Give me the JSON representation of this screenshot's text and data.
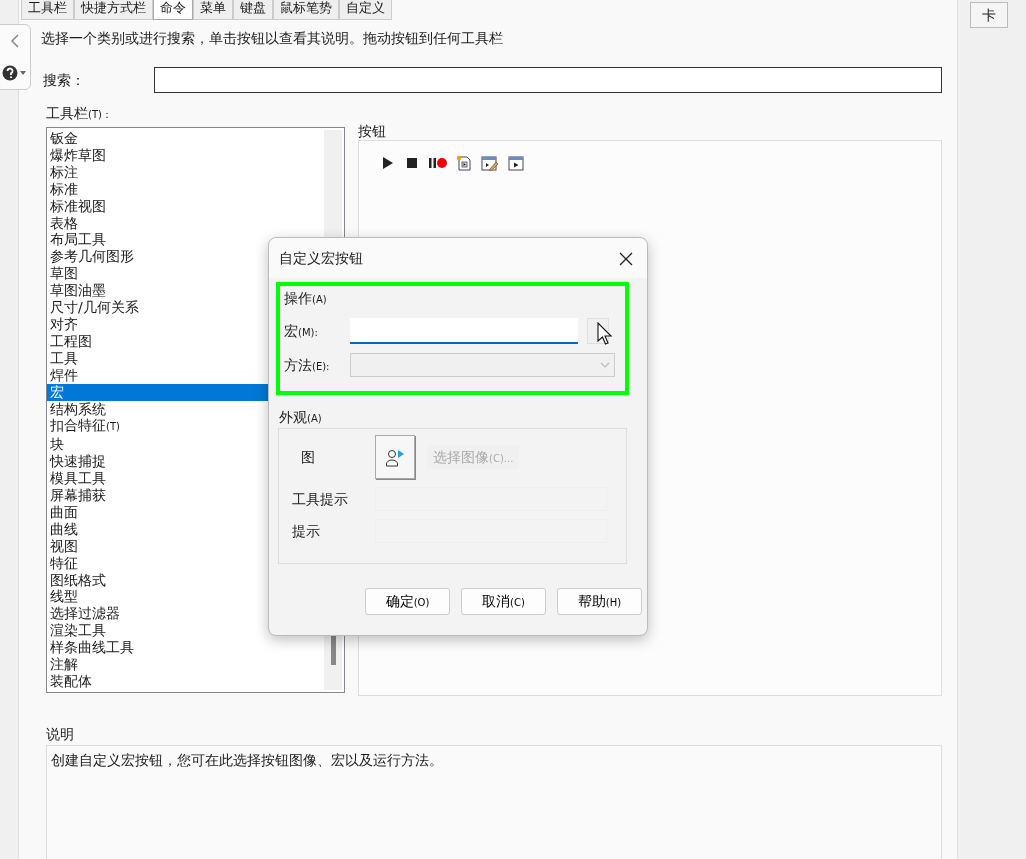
{
  "tabs": [
    {
      "label": "工具栏",
      "selected": false
    },
    {
      "label": "快捷方式栏",
      "selected": false
    },
    {
      "label": "命令",
      "selected": true
    },
    {
      "label": "菜单",
      "selected": false
    },
    {
      "label": "键盘",
      "selected": false
    },
    {
      "label": "鼠标笔势",
      "selected": false
    },
    {
      "label": "自定义",
      "selected": false
    }
  ],
  "right_strip": {
    "label": "卡"
  },
  "instruction": "选择一个类别或进行搜索，单击按钮以查看其说明。拖动按钮到任何工具栏",
  "search": {
    "label": "搜索："
  },
  "toolbars": {
    "label": "工具栏",
    "hotkey": "(T)：",
    "items": [
      {
        "label": "钣金",
        "selected": false
      },
      {
        "label": "爆炸草图",
        "selected": false
      },
      {
        "label": "标注",
        "selected": false
      },
      {
        "label": "标准",
        "selected": false
      },
      {
        "label": "标准视图",
        "selected": false
      },
      {
        "label": "表格",
        "selected": false
      },
      {
        "label": "布局工具",
        "selected": false
      },
      {
        "label": "参考几何图形",
        "selected": false
      },
      {
        "label": "草图",
        "selected": false
      },
      {
        "label": "草图油墨",
        "selected": false
      },
      {
        "label": "尺寸/几何关系",
        "selected": false
      },
      {
        "label": "对齐",
        "selected": false
      },
      {
        "label": "工程图",
        "selected": false
      },
      {
        "label": "工具",
        "selected": false
      },
      {
        "label": "焊件",
        "selected": false
      },
      {
        "label": "宏",
        "selected": true
      },
      {
        "label": "结构系统",
        "selected": false
      },
      {
        "label": "扣合特征",
        "hotkey": "(T)",
        "selected": false
      },
      {
        "label": "块",
        "selected": false
      },
      {
        "label": "快速捕捉",
        "selected": false
      },
      {
        "label": "模具工具",
        "selected": false
      },
      {
        "label": "屏幕捕获",
        "selected": false
      },
      {
        "label": "曲面",
        "selected": false
      },
      {
        "label": "曲线",
        "selected": false
      },
      {
        "label": "视图",
        "selected": false
      },
      {
        "label": "特征",
        "selected": false
      },
      {
        "label": "图纸格式",
        "selected": false
      },
      {
        "label": "线型",
        "selected": false
      },
      {
        "label": "选择过滤器",
        "selected": false
      },
      {
        "label": "渲染工具",
        "selected": false
      },
      {
        "label": "样条曲线工具",
        "selected": false
      },
      {
        "label": "注解",
        "selected": false
      },
      {
        "label": "装配体",
        "selected": false
      }
    ]
  },
  "buttons_group": {
    "title": "按钮",
    "icons": [
      {
        "kind": "play"
      },
      {
        "kind": "stop"
      },
      {
        "kind": "pause_record"
      },
      {
        "kind": "new_macro"
      },
      {
        "kind": "edit_macro"
      },
      {
        "kind": "run_macro"
      }
    ]
  },
  "description": {
    "title": "说明",
    "text": "创建自定义宏按钮，您可在此选择按钮图像、宏以及运行方法。"
  },
  "dialog": {
    "title": "自定义宏按钮",
    "operation": {
      "title": "操作",
      "hotkey": "(A)",
      "highlighted": true,
      "macro": {
        "label": "宏",
        "hotkey": "(M):"
      },
      "method": {
        "label": "方法",
        "hotkey": "(E):",
        "disabled": true
      }
    },
    "appearance": {
      "title": "外观",
      "hotkey": "(A)",
      "image_label": "图",
      "choose_image": {
        "label": "选择图像",
        "hotkey": "(C)...",
        "disabled": true
      },
      "tooltip": {
        "label": "工具提示",
        "disabled": true
      },
      "hint": {
        "label": "提示",
        "disabled": true
      }
    },
    "buttons": [
      {
        "label": "确定",
        "hotkey": "(O)"
      },
      {
        "label": "取消",
        "hotkey": "(C)"
      },
      {
        "label": "帮助",
        "hotkey": "(H)"
      }
    ]
  }
}
